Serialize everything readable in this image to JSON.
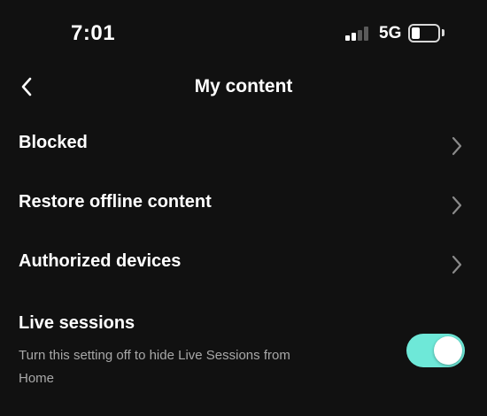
{
  "status_bar": {
    "time": "7:01",
    "network": "5G",
    "signal_bars_filled": 2,
    "signal_bars_total": 4,
    "icons": [
      "cellular-signal-icon",
      "battery-icon"
    ]
  },
  "header": {
    "title": "My content",
    "back_icon": "chevron-left-icon"
  },
  "menu": {
    "items": [
      {
        "label": "Blocked",
        "icon": "chevron-right-icon"
      },
      {
        "label": "Restore offline content",
        "icon": "chevron-right-icon"
      },
      {
        "label": "Authorized devices",
        "icon": "chevron-right-icon"
      }
    ]
  },
  "live_sessions": {
    "title": "Live sessions",
    "description": "Turn this setting off to hide Live Sessions from Home",
    "enabled": true
  },
  "colors": {
    "background": "#111111",
    "text_primary": "#ffffff",
    "text_secondary": "#a8a8a8",
    "chevron": "#8a8a8a",
    "toggle_on": "#6ee8d8"
  }
}
